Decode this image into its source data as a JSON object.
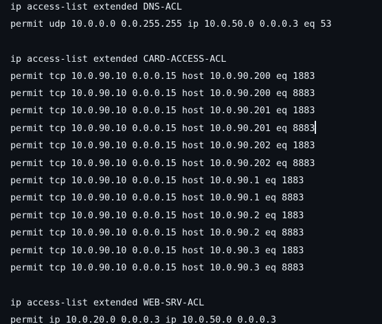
{
  "terminal": {
    "lines": [
      "ip access-list extended DNS-ACL",
      "permit udp 10.0.0.0 0.0.255.255 ip 10.0.50.0 0.0.0.3 eq 53",
      "",
      "ip access-list extended CARD-ACCESS-ACL",
      "permit tcp 10.0.90.10 0.0.0.15 host 10.0.90.200 eq 1883",
      "permit tcp 10.0.90.10 0.0.0.15 host 10.0.90.200 eq 8883",
      "permit tcp 10.0.90.10 0.0.0.15 host 10.0.90.201 eq 1883",
      "permit tcp 10.0.90.10 0.0.0.15 host 10.0.90.201 eq 8883",
      "permit tcp 10.0.90.10 0.0.0.15 host 10.0.90.202 eq 1883",
      "permit tcp 10.0.90.10 0.0.0.15 host 10.0.90.202 eq 8883",
      "permit tcp 10.0.90.10 0.0.0.15 host 10.0.90.1 eq 1883",
      "permit tcp 10.0.90.10 0.0.0.15 host 10.0.90.1 eq 8883",
      "permit tcp 10.0.90.10 0.0.0.15 host 10.0.90.2 eq 1883",
      "permit tcp 10.0.90.10 0.0.0.15 host 10.0.90.2 eq 8883",
      "permit tcp 10.0.90.10 0.0.0.15 host 10.0.90.3 eq 1883",
      "permit tcp 10.0.90.10 0.0.0.15 host 10.0.90.3 eq 8883",
      "",
      "ip access-list extended WEB-SRV-ACL",
      "permit ip 10.0.20.0 0.0.0.3 ip 10.0.50.0 0.0.0.3"
    ]
  }
}
